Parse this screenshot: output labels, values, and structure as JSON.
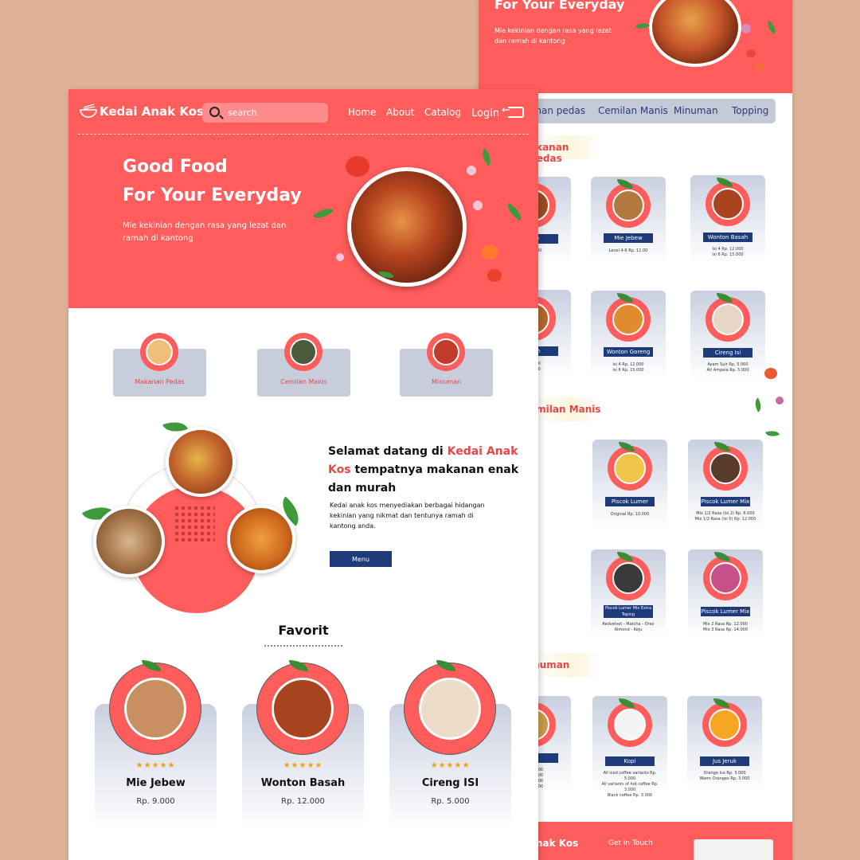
{
  "colors": {
    "accent": "#ff5c5c",
    "navy": "#1f3a79",
    "background": "#dfb196",
    "star": "#f5a014"
  },
  "back": {
    "hero": {
      "title": "For Your Everyday",
      "subtitle": "Mie kekinian dengan rasa yang lezat dan ramah di kantong"
    },
    "tabs": [
      "anan pedas",
      "Cemilan Manis",
      "Minuman",
      "Topping"
    ],
    "sections": {
      "pedas": "akanan Pedas",
      "manis": "emilan Manis",
      "minuman": "inuman"
    },
    "products": {
      "p1": {
        "label": "bew",
        "info": "p. 9.000"
      },
      "p2": {
        "label": "Mie Jebew",
        "info": "Level 4-6     Rp. 11.00"
      },
      "p3": {
        "label": "Wonton Basah",
        "info": "Isi 4     Rp. 12.000\nIsi 6     Rp. 15.000"
      },
      "p4": {
        "label": "Kuah",
        "info": "12.000\n15.000"
      },
      "p5": {
        "label": "Wonton Goreng",
        "info": "Isi 4     Rp. 12.000\nIsi 6     Rp. 15.000"
      },
      "p6": {
        "label": "Cireng Isi",
        "info": "Ayam Suir     Rp. 5.000\nAti Ampela    Rp. 5.000"
      },
      "p7": {
        "label": "Piscok Lumer",
        "info": "Original     Rp. 10.000"
      },
      "p8": {
        "label": "Piscok Lumer Mix",
        "info": "Mix 1/2 Rasa (Isi 2)    Rp. 6.000\nMix 1/2 Rasa (Isi 5)    Rp. 12.000"
      },
      "p9": {
        "label": "Piscok Lumer Mix Extra Toping",
        "info": "Redvelvet - Matcha - Oreo\nAlmond - Keju"
      },
      "p10": {
        "label": "Piscok Lumer Mix",
        "info": "Mix 2 Rasa     Rp. 12.000\nMix 3 Rasa     Rp. 14.000"
      },
      "p11": {
        "label": "",
        "info": "Rp. 2.500\nRp. 3.000\nRp. 2.500\nRp. 4.000"
      },
      "p12": {
        "label": "Kopi",
        "info": "All iced coffee variants     Rp. 5.000\nAll variants of hot coffee   Rp. 3.000\nBlack coffee                 Rp. 3.000"
      },
      "p13": {
        "label": "Jus Jeruk",
        "info": "Orange Ice        Rp. 3.000\nWarm Oranges   Rp. 3.000"
      }
    },
    "footer": {
      "brand": "nak Kos",
      "contact_title": "Get in Touch"
    }
  },
  "front": {
    "brand": "Kedai Anak Kos",
    "search": {
      "placeholder": "search"
    },
    "nav": {
      "home": "Home",
      "about": "About",
      "catalog": "Catalog",
      "login": "Login"
    },
    "hero": {
      "title_line1": "Good Food",
      "title_line2": "For Your Everyday",
      "subtitle": "Mie kekinian dengan rasa yang lezat dan ramah di kantong"
    },
    "categories": [
      "Makanan Pedas",
      "Cemilan Manis",
      "Minuman"
    ],
    "about": {
      "title_prefix": "Selamat datang di ",
      "title_highlight": "Kedai Anak Kos",
      "title_rest": "tempatnya makanan enak dan murah",
      "text": "Kedai anak kos menyediakan berbagai hidangan kekinian yang nikmat dan tentunya ramah di kantong anda.",
      "button": "Menu"
    },
    "favorites": {
      "title": "Favorit",
      "items": [
        {
          "name": "Mie Jebew",
          "price": "Rp. 9.000",
          "stars": "★★★★★"
        },
        {
          "name": "Wonton Basah",
          "price": "Rp. 12.000",
          "stars": "★★★★★"
        },
        {
          "name": "Cireng ISI",
          "price": "Rp. 5.000",
          "stars": "★★★★★"
        }
      ]
    }
  }
}
